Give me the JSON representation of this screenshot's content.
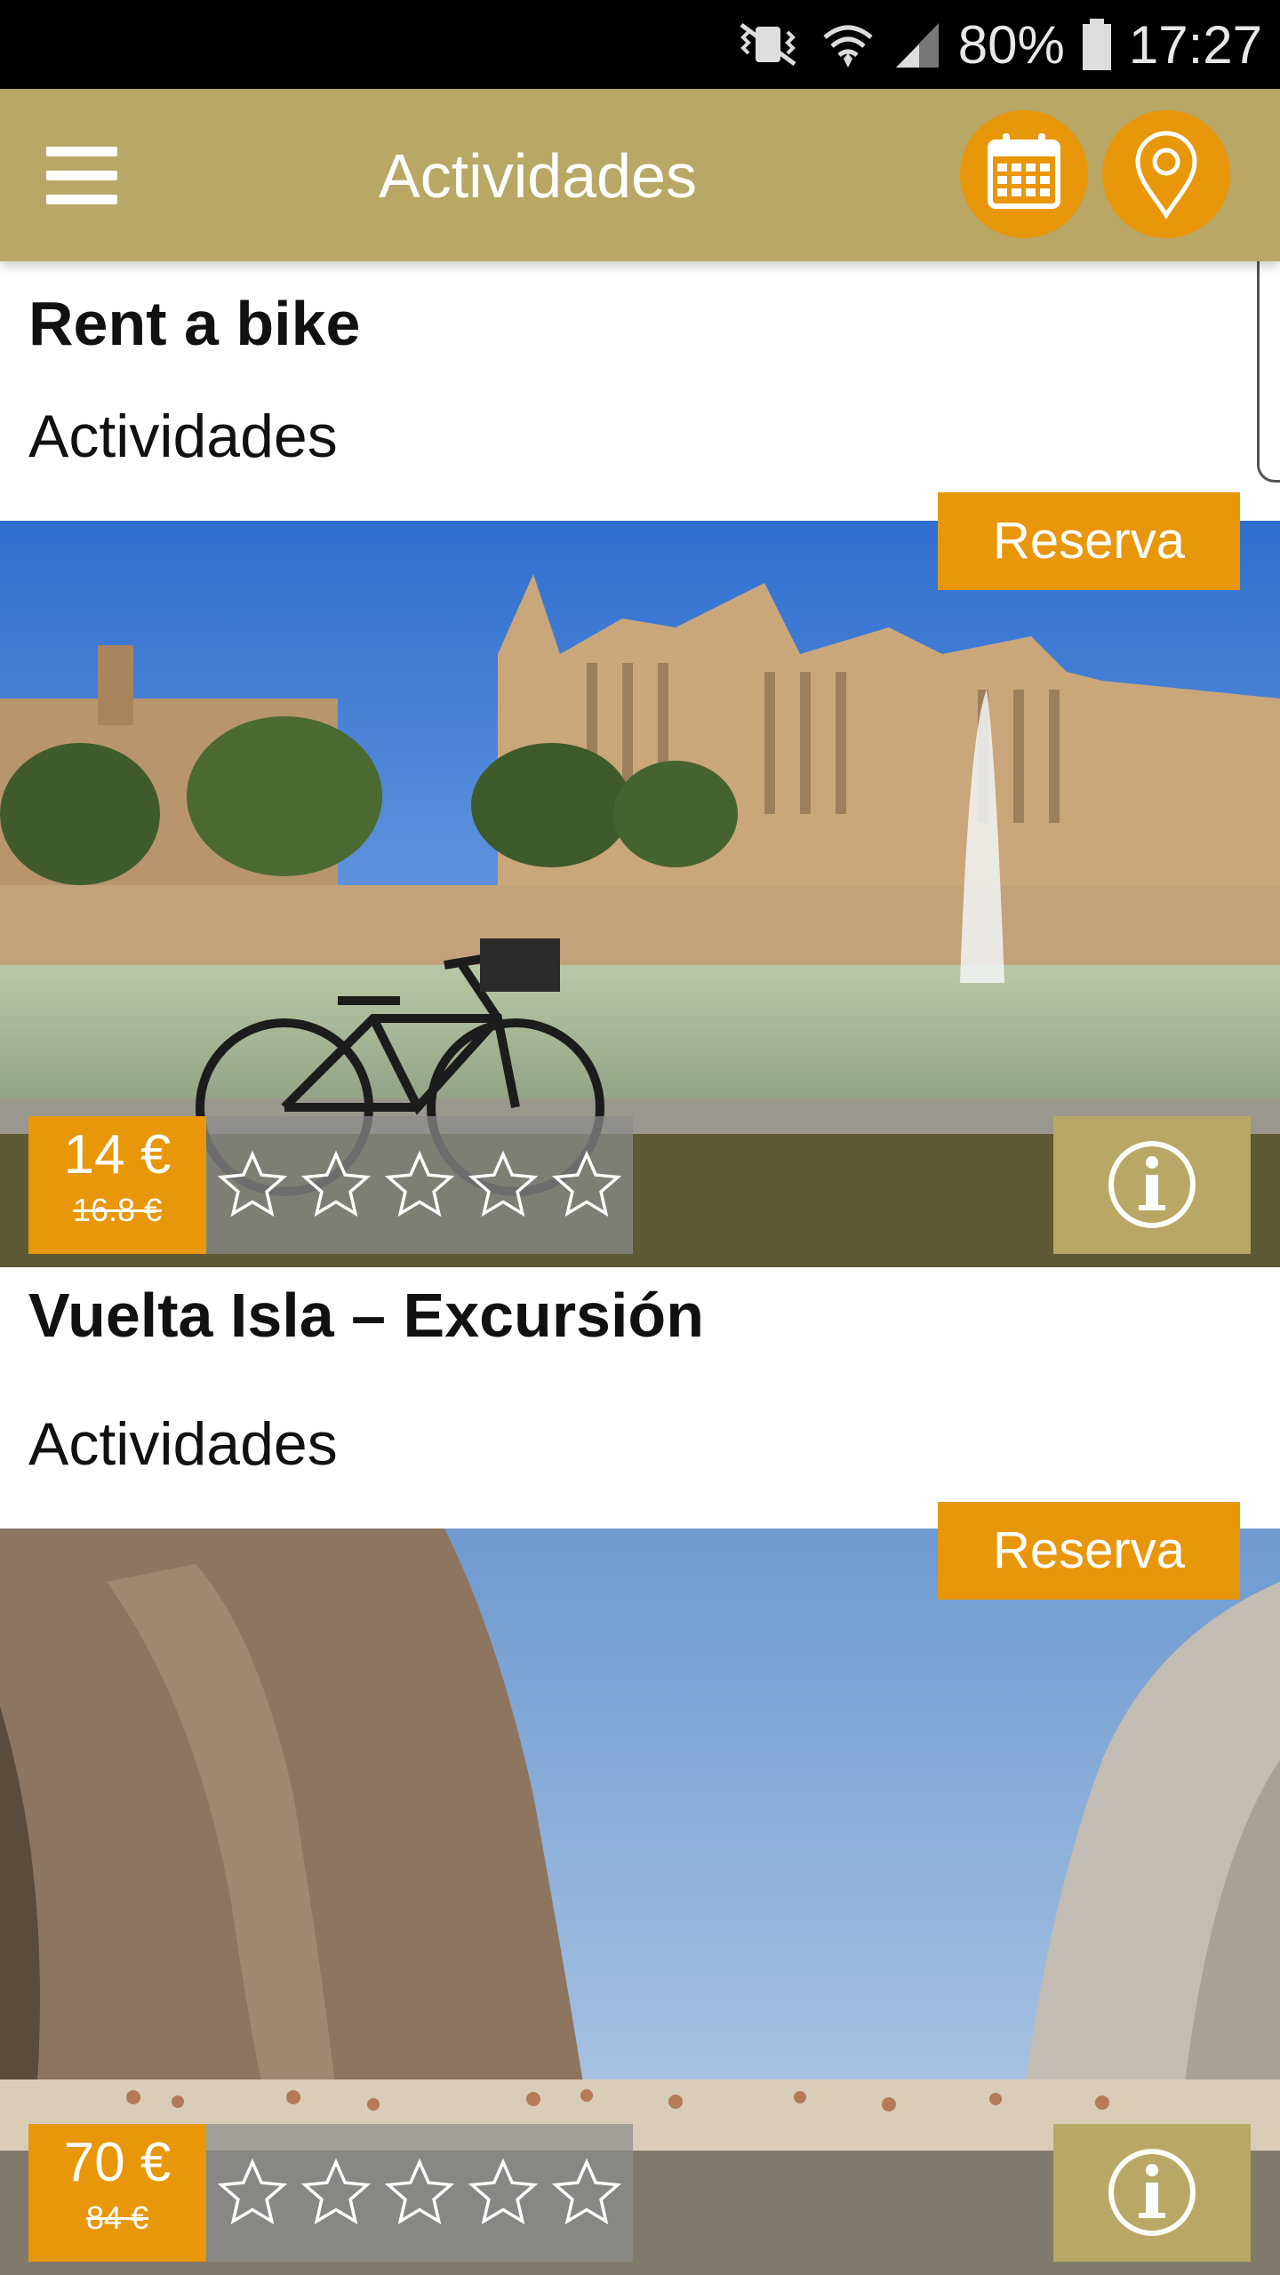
{
  "status": {
    "battery": "80%",
    "time": "17:27"
  },
  "appbar": {
    "title": "Actividades"
  },
  "colors": {
    "accent": "#e8960a",
    "bar": "#b9a765"
  },
  "cards": [
    {
      "title": "Rent a bike",
      "category": "Actividades",
      "reserve_label": "Reserva",
      "price": "14 €",
      "old_price": "16.8 €",
      "rating": 0,
      "rating_max": 5,
      "image": "palma-cathedral-with-bicycle-photo"
    },
    {
      "title": "Vuelta Isla – Excursión",
      "category": "Actividades",
      "reserve_label": "Reserva",
      "price": "70 €",
      "old_price": "84 €",
      "rating": 0,
      "rating_max": 5,
      "image": "sa-calobra-gorge-beach-photo"
    }
  ]
}
